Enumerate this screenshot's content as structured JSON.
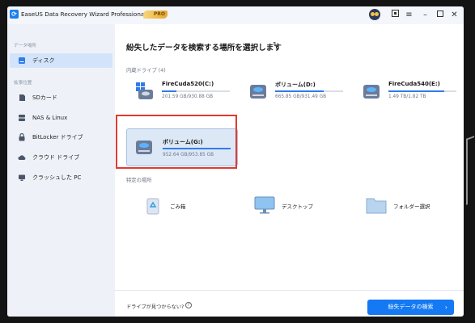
{
  "titlebar": {
    "app_title": "EaseUS Data Recovery Wizard Professional",
    "badge": "PRO",
    "controls": [
      "avatar-icon",
      "restore-icon",
      "menu-icon",
      "minimize-icon",
      "maximize-icon",
      "close-icon"
    ]
  },
  "sidebar": {
    "section1_label": "データ場所",
    "section2_label": "拡張位置",
    "items": [
      {
        "label": "ディスク",
        "icon": "disk-icon",
        "active": true
      },
      {
        "label": "SDカード",
        "icon": "sd-card-icon"
      },
      {
        "label": "NAS & Linux",
        "icon": "nas-icon"
      },
      {
        "label": "BitLocker ドライブ",
        "icon": "bitlocker-icon"
      },
      {
        "label": "クラウド ドライブ",
        "icon": "cloud-icon"
      },
      {
        "label": "クラッシュした PC",
        "icon": "crashed-pc-icon"
      }
    ]
  },
  "main": {
    "heading": "紛失したデータを検索する場所を選択します",
    "drives_label": "内蔵ドライブ (4)",
    "drives": [
      {
        "name": "FireCuda520(C:)",
        "size": "201.59 GB/930.88 GB",
        "used": 0.22
      },
      {
        "name": "ボリューム(D:)",
        "size": "665.85 GB/931.49 GB",
        "used": 0.71
      },
      {
        "name": "FireCuda540(E:)",
        "size": "1.49 TB/1.82 TB",
        "used": 0.82
      },
      {
        "name": "ボリューム(G:)",
        "size": "952.64 GB/953.85 GB",
        "used": 0.998,
        "selected": true
      }
    ],
    "locations_label": "特定の場所",
    "locations": [
      {
        "label": "ごみ箱",
        "icon": "recycle-bin-icon"
      },
      {
        "label": "デスクトップ",
        "icon": "desktop-icon"
      },
      {
        "label": "フォルダー選択",
        "icon": "folder-icon"
      }
    ],
    "footer_text": "ドライブが見つからない?",
    "scan_button": "紛失データの検索"
  },
  "colors": {
    "accent": "#1479f2",
    "highlight": "#e23a2f",
    "sidebar_bg": "#eef2f8",
    "active_item": "#d3e4fa"
  }
}
